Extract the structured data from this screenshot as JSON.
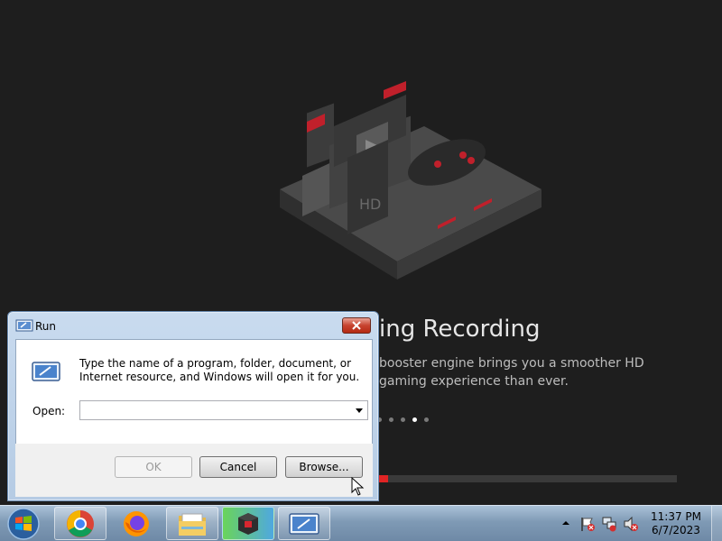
{
  "app": {
    "slide_title": "ing Recording",
    "slide_description": "booster engine brings you a smoother HD gaming experience than ever.",
    "hero_sd_label": "HD",
    "carousel": {
      "count": 5,
      "active_index": 3
    },
    "progress_fraction": 0.03,
    "accent_color": "#e02424"
  },
  "run_dialog": {
    "title": "Run",
    "description": "Type the name of a program, folder, document, or Internet resource, and Windows will open it for you.",
    "open_label": "Open:",
    "open_value": "",
    "ok_label": "OK",
    "cancel_label": "Cancel",
    "browse_label": "Browse..."
  },
  "taskbar": {
    "apps": [
      {
        "name": "chrome-icon"
      },
      {
        "name": "firefox-icon"
      },
      {
        "name": "file-explorer-icon"
      },
      {
        "name": "recorder-app-icon"
      },
      {
        "name": "run-icon"
      }
    ],
    "clock_time": "11:37 PM",
    "clock_date": "6/7/2023"
  }
}
